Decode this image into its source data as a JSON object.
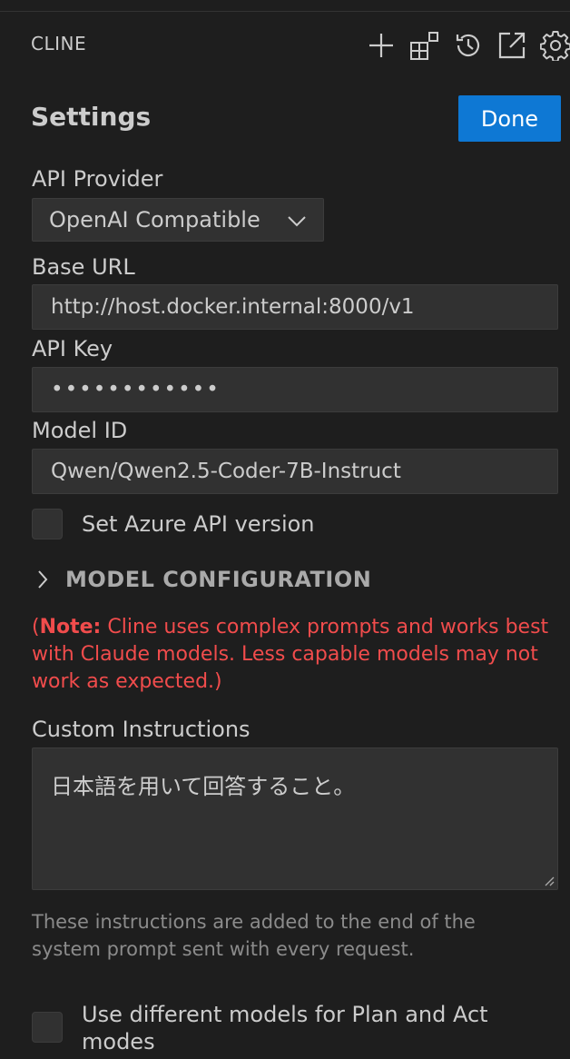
{
  "header": {
    "title": "CLINE",
    "icons": [
      "plus-icon",
      "mcp-servers-icon",
      "history-icon",
      "popout-icon",
      "gear-icon"
    ]
  },
  "settings": {
    "title": "Settings",
    "done_label": "Done"
  },
  "api_provider": {
    "label": "API Provider",
    "value": "OpenAI Compatible"
  },
  "base_url": {
    "label": "Base URL",
    "value": "http://host.docker.internal:8000/v1"
  },
  "api_key": {
    "label": "API Key",
    "value": "••••••••••••"
  },
  "model_id": {
    "label": "Model ID",
    "value": "Qwen/Qwen2.5-Coder-7B-Instruct"
  },
  "azure": {
    "label": "Set Azure API version",
    "checked": false
  },
  "model_configuration": {
    "label": "MODEL CONFIGURATION",
    "expanded": false
  },
  "note": {
    "open_paren": "(",
    "prefix": "Note:",
    "text": " Cline uses complex prompts and works best with Claude models. Less capable models may not work as expected.)"
  },
  "custom_instructions": {
    "label": "Custom Instructions",
    "value": "日本語を用いて回答すること。",
    "help": "These instructions are added to the end of the system prompt sent with every request."
  },
  "plan_act": {
    "label": "Use different models for Plan and Act modes",
    "checked": false
  },
  "colors": {
    "background": "#1e1e1e",
    "input_background": "#313131",
    "accent": "#0e78d4",
    "error": "#f14c4c",
    "text": "#cccccc",
    "muted": "#8b8b8b"
  }
}
